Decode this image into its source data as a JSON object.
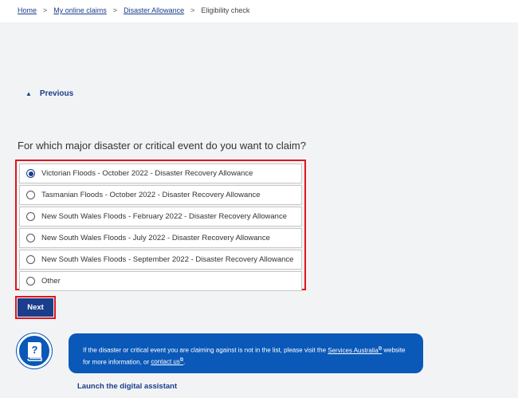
{
  "breadcrumb": {
    "home": "Home",
    "claims": "My online claims",
    "allowance": "Disaster Allowance",
    "current": "Eligibility check",
    "separator": ">"
  },
  "nav": {
    "previous": "Previous",
    "previous_icon": "chevron-up-icon"
  },
  "question": "For which major disaster or critical event do you want to claim?",
  "options": [
    {
      "label": "Victorian Floods - October 2022 - Disaster Recovery Allowance",
      "selected": true
    },
    {
      "label": "Tasmanian Floods - October 2022 - Disaster Recovery Allowance",
      "selected": false
    },
    {
      "label": "New South Wales Floods - February 2022 - Disaster Recovery Allowance",
      "selected": false
    },
    {
      "label": "New South Wales Floods - July 2022 - Disaster Recovery Allowance",
      "selected": false
    },
    {
      "label": "New South Wales Floods - September 2022 - Disaster Recovery Allowance",
      "selected": false
    },
    {
      "label": "Other",
      "selected": false
    }
  ],
  "next_label": "Next",
  "assistant": {
    "text_before": "If the disaster or critical event you are claiming against is not in the list, please visit the ",
    "link_services": "Services Australia",
    "text_middle": " website for more information, or ",
    "link_contact": "contact us",
    "text_after": ".",
    "launch": "Launch the digital assistant",
    "icon": "chat-help-icon"
  },
  "colors": {
    "primary": "#1a3e8c",
    "bubble": "#0a58b8",
    "highlight": "#e0161c",
    "background": "#f2f3f5"
  }
}
